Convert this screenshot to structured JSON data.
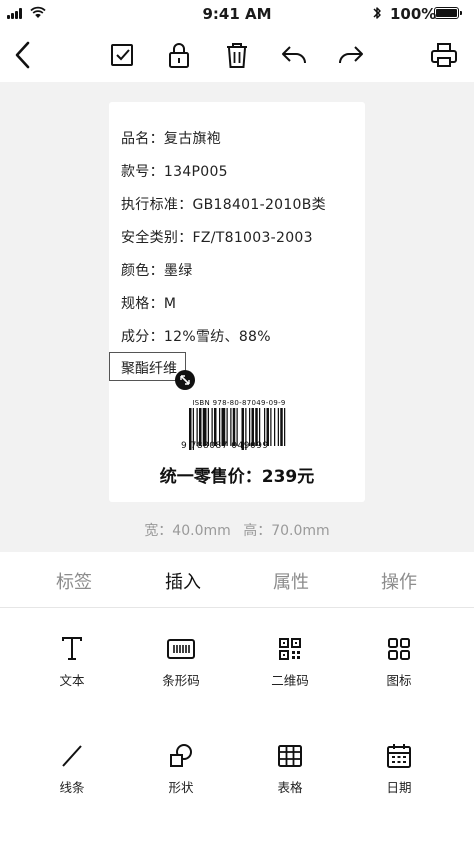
{
  "status_bar": {
    "time": "9:41 AM",
    "battery": "100%"
  },
  "label": {
    "fields": [
      {
        "key": "name",
        "text": "品名：复古旗袍"
      },
      {
        "key": "style",
        "text": "款号：134P005"
      },
      {
        "key": "standard",
        "text": "执行标准：GB18401-2010B类"
      },
      {
        "key": "safety",
        "text": "安全类别：FZ/T81003-2003"
      },
      {
        "key": "color",
        "text": "颜色：墨绿"
      },
      {
        "key": "size",
        "text": "规格：M"
      },
      {
        "key": "composition",
        "text": "成分：12%雪纺、88%"
      }
    ],
    "selected_text": "聚酯纤维",
    "isbn": "ISBN  978-80-87049-09-9",
    "barcode_number": "9  788087  049099",
    "price": "统一零售价：239元"
  },
  "dimensions": {
    "width": "宽：40.0mm",
    "height": "高：70.0mm"
  },
  "tabs": [
    {
      "label": "标签",
      "active": false
    },
    {
      "label": "插入",
      "active": true
    },
    {
      "label": "属性",
      "active": false
    },
    {
      "label": "操作",
      "active": false
    }
  ],
  "tools": [
    {
      "label": "文本",
      "icon": "text-icon"
    },
    {
      "label": "条形码",
      "icon": "barcode-icon"
    },
    {
      "label": "二维码",
      "icon": "qrcode-icon"
    },
    {
      "label": "图标",
      "icon": "grid-icon"
    },
    {
      "label": "线条",
      "icon": "line-icon"
    },
    {
      "label": "形状",
      "icon": "shape-icon"
    },
    {
      "label": "表格",
      "icon": "table-icon"
    },
    {
      "label": "日期",
      "icon": "calendar-icon"
    }
  ]
}
